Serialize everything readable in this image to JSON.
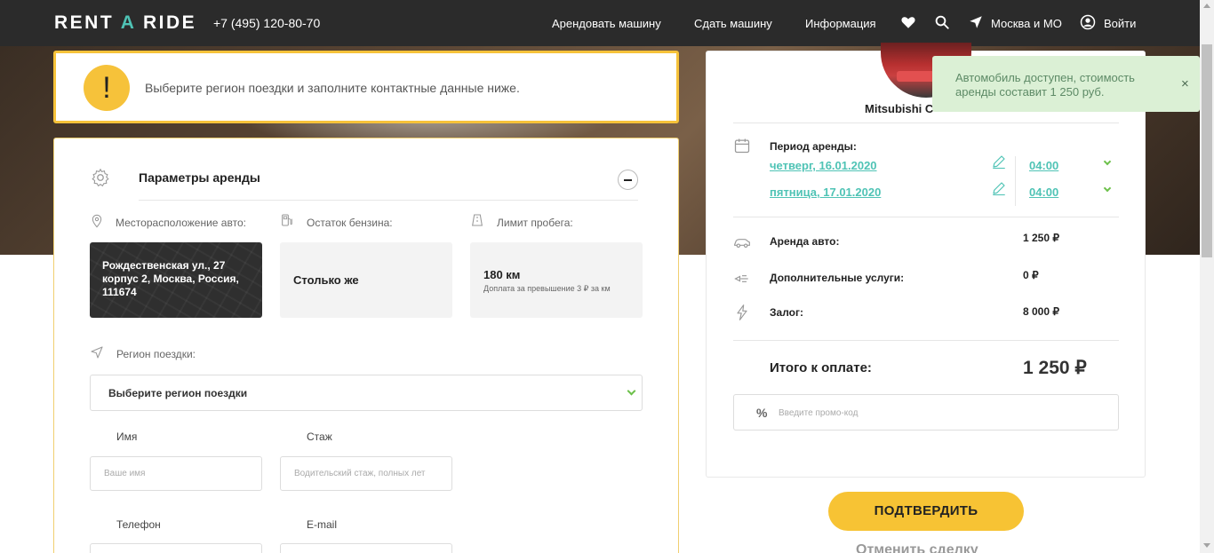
{
  "header": {
    "logo_left": "RENT ",
    "logo_accent": "A",
    "logo_right": " RIDE",
    "phone": "+7 (495) 120-80-70",
    "nav_rent": "Арендовать машину",
    "nav_list": "Сдать машину",
    "nav_info": "Информация",
    "region": "Москва и МО",
    "login": "Войти"
  },
  "alert": {
    "icon": "!",
    "text": "Выберите регион поездки и заполните контактные данные ниже."
  },
  "params": {
    "title": "Параметры аренды",
    "location_label": "Месторасположение авто:",
    "location_value": "Рождественская ул., 27 корпус 2, Москва, Россия, 111674",
    "fuel_label": "Остаток бензина:",
    "fuel_value": "Столько же",
    "limit_label": "Лимит пробега:",
    "limit_value": "180 км",
    "limit_note": "Доплата за превышение 3 ₽ за км",
    "region_label": "Регион поездки:",
    "region_select": "Выберите регион поездки",
    "name_label": "Имя",
    "name_placeholder": "Ваше имя",
    "exp_label": "Стаж",
    "exp_placeholder": "Водительский стаж, полных лет",
    "phone_label": "Телефон",
    "email_label": "E-mail"
  },
  "summary": {
    "car_name": "Mitsubishi C",
    "period_label": "Период аренды:",
    "date_start": "четверг, 16.01.2020",
    "time_start": "04:00",
    "date_end": "пятница, 17.01.2020",
    "time_end": "04:00",
    "rent_label": "Аренда авто:",
    "rent_value": "1 250 ₽",
    "extras_label": "Дополнительные услуги:",
    "extras_value": "0 ₽",
    "deposit_label": "Залог:",
    "deposit_value": "8 000 ₽",
    "total_label": "Итого к оплате:",
    "total_value": "1 250 ₽",
    "promo_symbol": "%",
    "promo_placeholder": "Введите промо-код"
  },
  "toast": {
    "text": "Автомобиль доступен, стоимость аренды составит 1 250 руб.",
    "close": "×"
  },
  "actions": {
    "confirm": "ПОДТВЕРДИТЬ",
    "cancel": "Отменить сделку"
  },
  "colors": {
    "accent_teal": "#4fc3b5",
    "accent_yellow": "#f7c334",
    "toast_bg": "#dbf0d5",
    "header_bg": "#2b2b2b"
  }
}
